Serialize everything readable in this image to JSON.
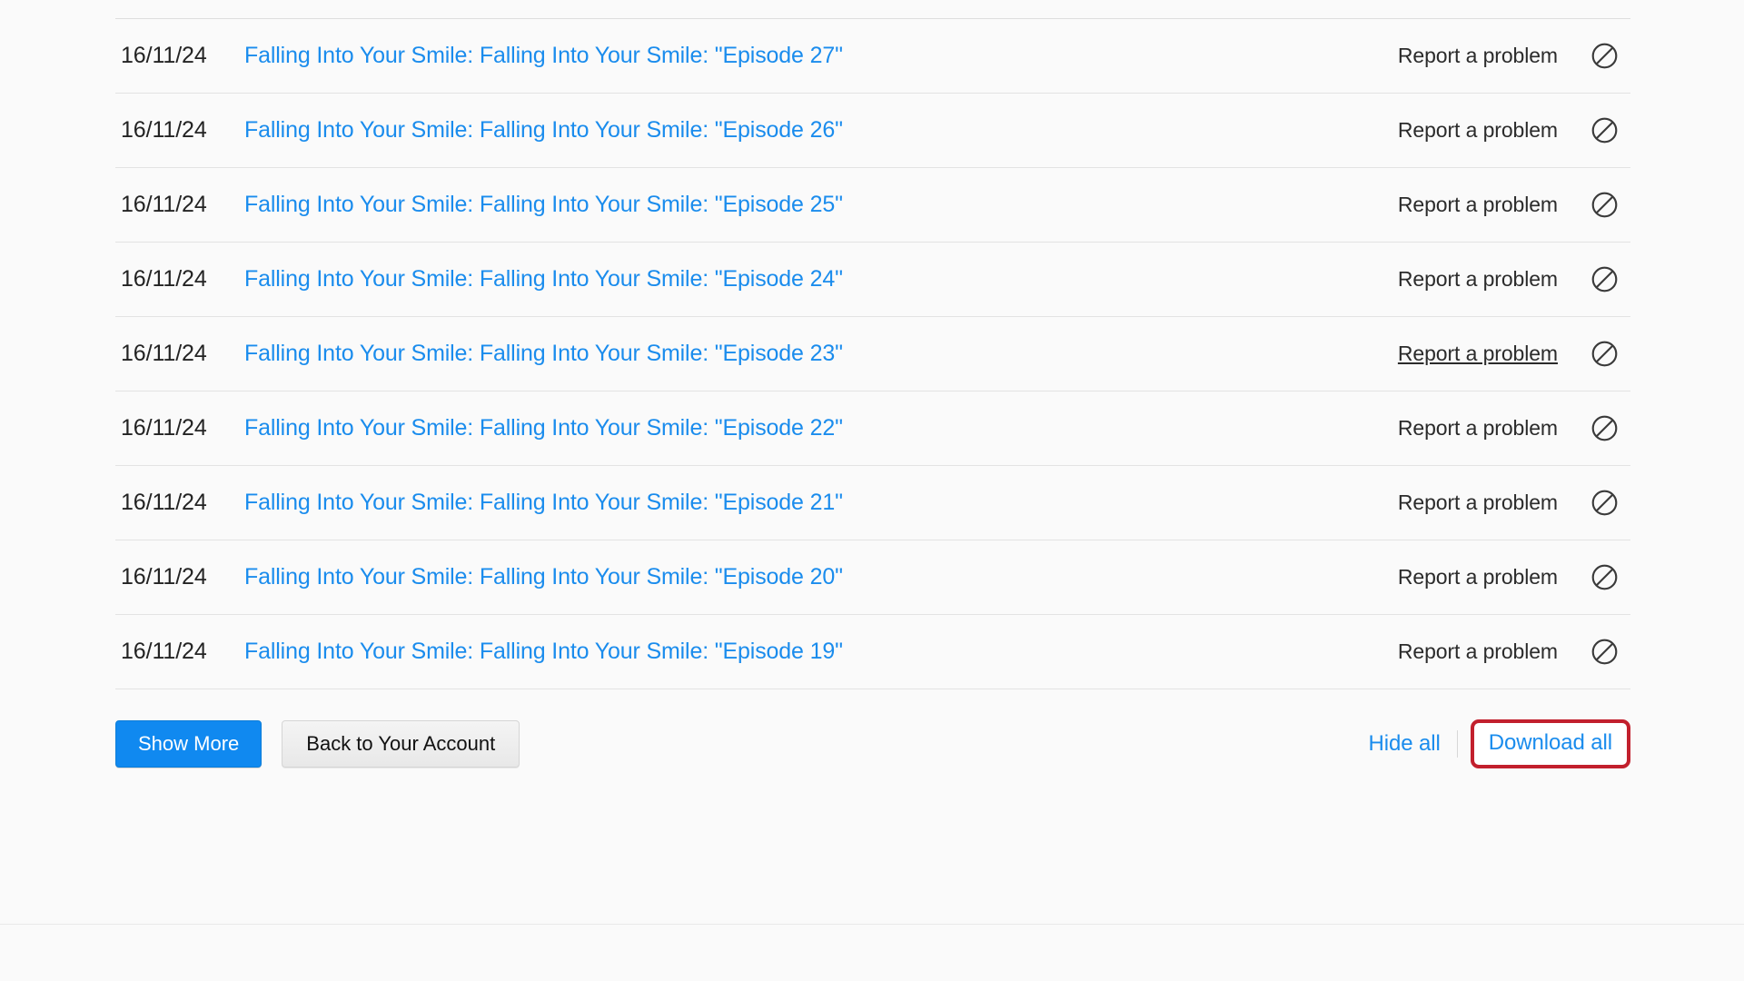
{
  "page": {
    "background_color": "#fafafa",
    "link_color": "#1a8ced",
    "text_color": "#232323",
    "highlight_color": "#c2202d"
  },
  "table": {
    "columns": [
      "date",
      "title",
      "report",
      "action"
    ],
    "rows": [
      {
        "date": "16/11/24",
        "title": "Falling Into Your Smile: Falling Into Your Smile: \"Episode 27\"",
        "report_label": "Report a problem",
        "action_icon": "no-entry-icon",
        "report_hovered": false
      },
      {
        "date": "16/11/24",
        "title": "Falling Into Your Smile: Falling Into Your Smile: \"Episode 26\"",
        "report_label": "Report a problem",
        "action_icon": "no-entry-icon",
        "report_hovered": false
      },
      {
        "date": "16/11/24",
        "title": "Falling Into Your Smile: Falling Into Your Smile: \"Episode 25\"",
        "report_label": "Report a problem",
        "action_icon": "no-entry-icon",
        "report_hovered": false
      },
      {
        "date": "16/11/24",
        "title": "Falling Into Your Smile: Falling Into Your Smile: \"Episode 24\"",
        "report_label": "Report a problem",
        "action_icon": "no-entry-icon",
        "report_hovered": false
      },
      {
        "date": "16/11/24",
        "title": "Falling Into Your Smile: Falling Into Your Smile: \"Episode 23\"",
        "report_label": "Report a problem",
        "action_icon": "no-entry-icon",
        "report_hovered": true
      },
      {
        "date": "16/11/24",
        "title": "Falling Into Your Smile: Falling Into Your Smile: \"Episode 22\"",
        "report_label": "Report a problem",
        "action_icon": "no-entry-icon",
        "report_hovered": false
      },
      {
        "date": "16/11/24",
        "title": "Falling Into Your Smile: Falling Into Your Smile: \"Episode 21\"",
        "report_label": "Report a problem",
        "action_icon": "no-entry-icon",
        "report_hovered": false
      },
      {
        "date": "16/11/24",
        "title": "Falling Into Your Smile: Falling Into Your Smile: \"Episode 20\"",
        "report_label": "Report a problem",
        "action_icon": "no-entry-icon",
        "report_hovered": false
      },
      {
        "date": "16/11/24",
        "title": "Falling Into Your Smile: Falling Into Your Smile: \"Episode 19\"",
        "report_label": "Report a problem",
        "action_icon": "no-entry-icon",
        "report_hovered": false
      }
    ]
  },
  "actions": {
    "show_more_label": "Show More",
    "back_to_account_label": "Back to Your Account",
    "hide_all_label": "Hide all",
    "download_all_label": "Download all",
    "download_all_highlighted": true
  }
}
